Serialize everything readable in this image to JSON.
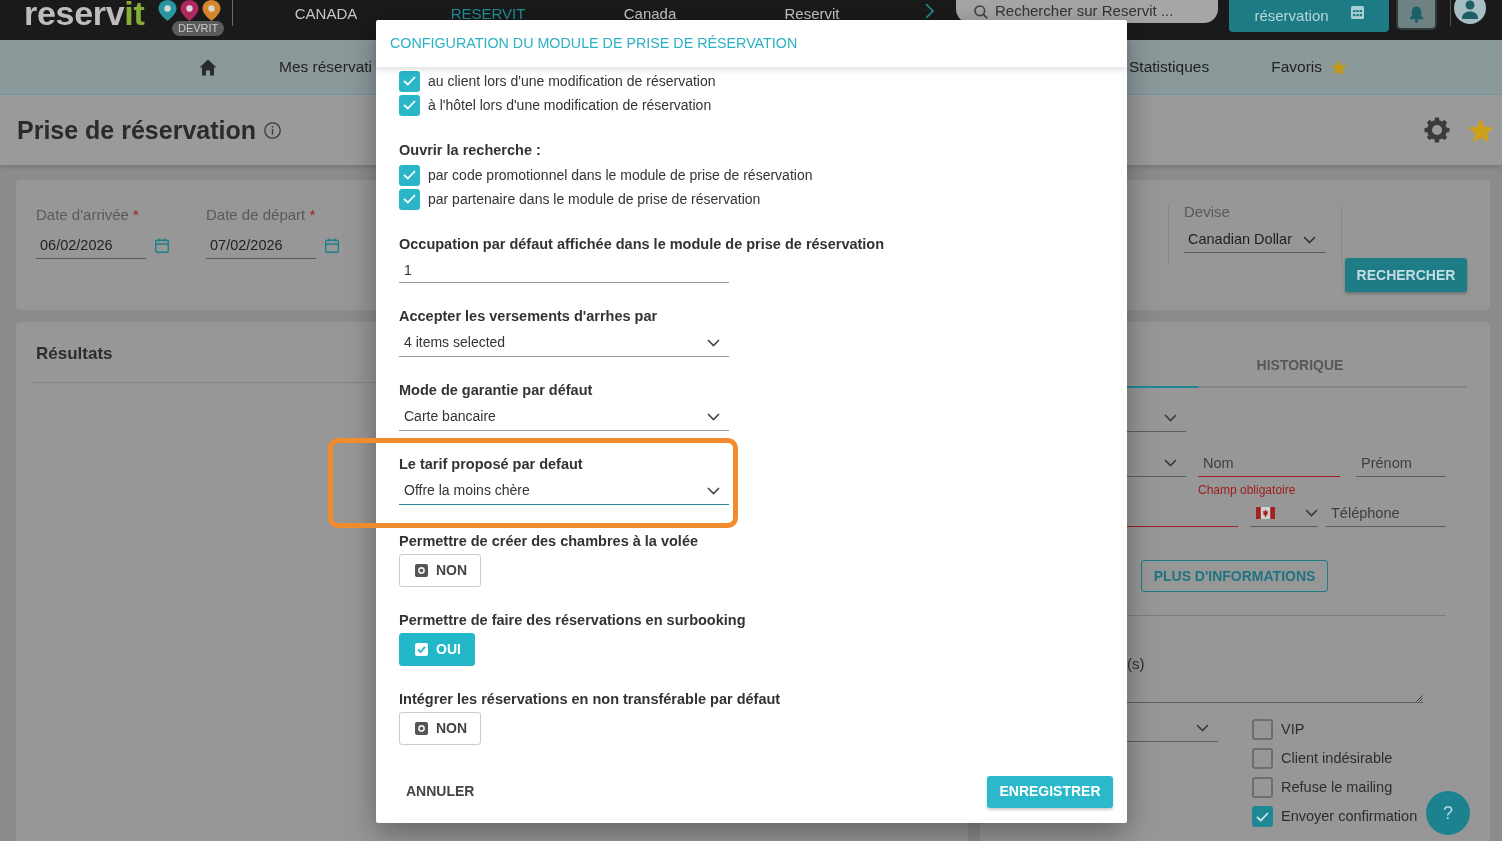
{
  "top_bar": {
    "logo_text": [
      "reserv",
      "it"
    ],
    "env_badge": "DEVRIT",
    "properties": [
      {
        "label": "CANADA",
        "selected": false
      },
      {
        "label": "RESERVIT",
        "selected": true
      },
      {
        "label": "Canada",
        "selected": false
      },
      {
        "label": "Reservit",
        "selected": false
      }
    ],
    "search": {
      "placeholder": "Rechercher sur Reservit ..."
    },
    "book_button": "réservation"
  },
  "main_nav": [
    {
      "kind": "home"
    },
    {
      "kind": "link",
      "label": "Mes réservati"
    },
    {
      "kind": "link",
      "label": "Statistiques"
    },
    {
      "kind": "favorites",
      "label": "Favoris"
    }
  ],
  "page_header": {
    "title": "Prise de réservation"
  },
  "search_form": {
    "dates": [
      {
        "label": "Date d'arrivée",
        "required_mark": "*",
        "value": "06/02/2026"
      },
      {
        "label": "Date de départ",
        "required_mark": "*",
        "value": "07/02/2026"
      }
    ],
    "currency": {
      "label": "Devise",
      "value": "Canadian Dollar"
    },
    "search_button": "RECHERCHER"
  },
  "results": {
    "title": "Résultats"
  },
  "guest_panel": {
    "tabs": [
      {
        "selected": true
      },
      {
        "label": "HISTORIQUE",
        "selected": false
      }
    ],
    "rows": [
      [
        {
          "kind": "select"
        }
      ],
      [
        {
          "kind": "select"
        },
        {
          "kind": "text",
          "placeholder": "Nom",
          "invalid": true,
          "error": "Champ obligatoire"
        },
        {
          "kind": "text",
          "placeholder": "Prénom",
          "invalid": false
        }
      ],
      [
        {
          "kind": "text",
          "invalid": true
        },
        {
          "kind": "country"
        },
        {
          "kind": "text",
          "placeholder": "Téléphone",
          "invalid": false
        }
      ]
    ],
    "more_button": "PLUS D'INFORMATIONS",
    "cut_label": "(s)",
    "flags": [
      {
        "label": "VIP",
        "checked": false
      },
      {
        "label": "Client indésirable",
        "checked": false
      },
      {
        "label": "Refuse le mailing",
        "checked": false
      },
      {
        "label": "Envoyer confirmation",
        "checked": true
      }
    ]
  },
  "dialog": {
    "title": "CONFIGURATION DU MODULE DE PRISE DE RÉSERVATION",
    "sections": [
      {
        "kind": "checklist",
        "items": [
          {
            "label": "au client lors d'une modification de réservation",
            "checked": true
          },
          {
            "label": "à l'hôtel lors d'une modification de réservation",
            "checked": true
          }
        ]
      },
      {
        "kind": "checklist",
        "title": "Ouvrir la recherche :",
        "items": [
          {
            "label": "par code promotionnel dans le module de prise de réservation",
            "checked": true
          },
          {
            "label": "par partenaire dans le module de prise de réservation",
            "checked": true
          }
        ]
      },
      {
        "kind": "input",
        "title": "Occupation par défaut affichée dans le module de prise de réservation",
        "value": "1"
      },
      {
        "kind": "select",
        "title": "Accepter les versements d'arrhes par",
        "value": "4 items selected",
        "focused": false
      },
      {
        "kind": "select",
        "title": "Mode de garantie par défaut",
        "value": "Carte bancaire",
        "focused": false
      },
      {
        "kind": "select",
        "title": "Le tarif proposé par defaut",
        "value": "Offre la moins chère",
        "focused": true,
        "highlighted": true
      },
      {
        "kind": "toggle",
        "title": "Permettre de créer des chambres à la volée",
        "label": "NON",
        "on": false
      },
      {
        "kind": "toggle",
        "title": "Permettre de faire des réservations en surbooking",
        "label": "OUI",
        "on": true
      },
      {
        "kind": "toggle",
        "title": "Intégrer les réservations en non transférable par défaut",
        "label": "NON",
        "on": false
      }
    ],
    "cancel_button": "ANNULER",
    "save_button": "ENREGISTRER"
  },
  "help_button": "?"
}
